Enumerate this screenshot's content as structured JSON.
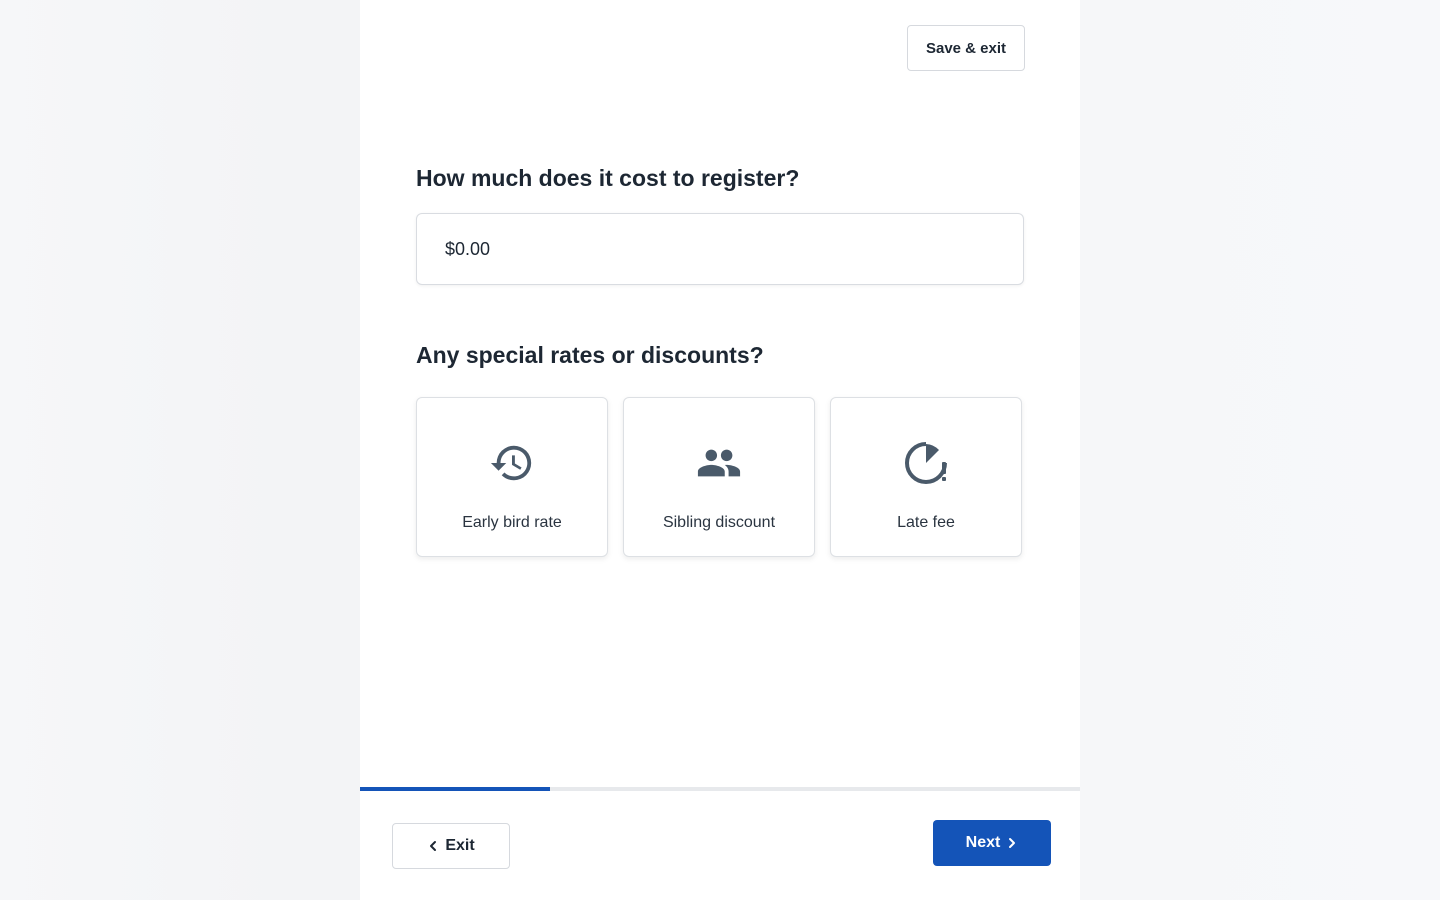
{
  "header": {
    "save_exit_label": "Save & exit"
  },
  "cost_section": {
    "question": "How much does it cost to register?",
    "input_value": "$0.00"
  },
  "discounts_section": {
    "question": "Any special rates or discounts?",
    "options": [
      {
        "label": "Early bird rate",
        "icon": "history-icon"
      },
      {
        "label": "Sibling discount",
        "icon": "people-icon"
      },
      {
        "label": "Late fee",
        "icon": "clock-alert-icon"
      }
    ]
  },
  "progress": {
    "fraction": 0.264
  },
  "footer": {
    "exit_label": "Exit",
    "next_label": "Next"
  },
  "colors": {
    "accent": "#1454b8",
    "icon": "#4a5a6a"
  }
}
